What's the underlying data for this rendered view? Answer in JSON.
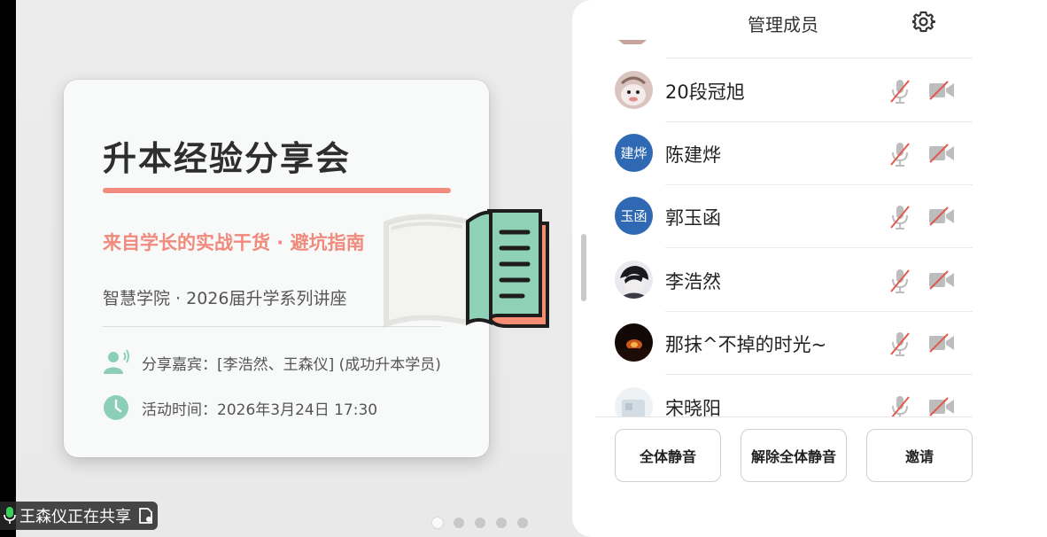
{
  "slide": {
    "title": "升本经验分享会",
    "subtitle": "来自学长的实战干货 · 避坑指南",
    "meta": "智慧学院 · 2026届升学系列讲座",
    "guests_label": "分享嘉宾：[李浩然、王森仪] (成功升本学员)",
    "time_label": "活动时间：2026年3月24日 17:30",
    "accent_color": "#f28b7d",
    "icons": [
      "speaker-person-icon",
      "clock-icon",
      "open-book-icon"
    ]
  },
  "pager": {
    "total": 5,
    "active_index": 0
  },
  "share_status": {
    "text": "王森仪正在共享",
    "icons": [
      "mic-icon",
      "share-doc-icon"
    ]
  },
  "panel": {
    "title": "管理成员",
    "members": [
      {
        "name": "20段冠旭",
        "avatar": "photo",
        "mic": "muted",
        "camera": "off"
      },
      {
        "name": "陈建烨",
        "avatar_text": "建烨",
        "mic": "muted",
        "camera": "off"
      },
      {
        "name": "郭玉函",
        "avatar_text": "玉函",
        "mic": "muted",
        "camera": "off"
      },
      {
        "name": "李浩然",
        "avatar": "photo",
        "mic": "muted",
        "camera": "off"
      },
      {
        "name": "那抹^不掉的时光~",
        "avatar": "photo",
        "mic": "muted",
        "camera": "off"
      },
      {
        "name": "宋晓阳",
        "avatar": "photo",
        "mic": "muted",
        "camera": "off"
      }
    ],
    "buttons": {
      "mute_all": "全体静音",
      "unmute_all": "解除全体静音",
      "invite": "邀请"
    },
    "colors": {
      "avatar_blue": "#2f69b4",
      "muted_red": "#e05a4f"
    }
  }
}
